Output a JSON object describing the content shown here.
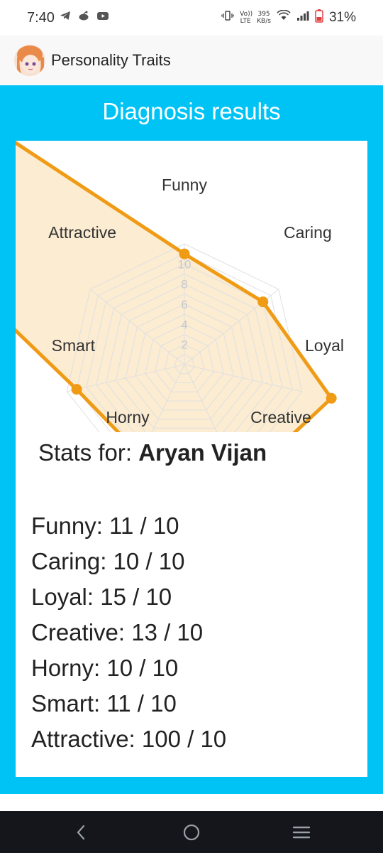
{
  "status_bar": {
    "time": "7:40",
    "network_speed_value": "395",
    "network_speed_unit": "KB/s",
    "volte_label": "Vo)) LTE",
    "battery": "31%",
    "left_icons": [
      "telegram-icon",
      "reddit-icon",
      "youtube-icon"
    ],
    "right_icons": [
      "vibrate-icon",
      "volte-icon",
      "wifi-icon",
      "signal-icon",
      "battery-icon"
    ]
  },
  "app_bar": {
    "title": "Personality Traits"
  },
  "results": {
    "heading": "Diagnosis results",
    "stats_prefix": "Stats for: ",
    "stats_name": "Aryan Vijan",
    "stats": [
      {
        "label": "Funny: 11 / 10"
      },
      {
        "label": "Caring: 10 / 10"
      },
      {
        "label": "Loyal: 15 / 10"
      },
      {
        "label": "Creative: 13 / 10"
      },
      {
        "label": "Horny: 10 / 10"
      },
      {
        "label": "Smart: 11 / 10"
      },
      {
        "label": "Attractive: 100 / 10"
      }
    ]
  },
  "chart_data": {
    "type": "radar",
    "categories": [
      "Funny",
      "Caring",
      "Loyal",
      "Creative",
      "Horny",
      "Smart",
      "Attractive"
    ],
    "values": [
      11,
      10,
      15,
      13,
      10,
      11,
      100
    ],
    "scale_ticks": [
      "2",
      "4",
      "6",
      "8",
      "10"
    ],
    "rmax": 12,
    "stroke_color": "#f09b15",
    "fill_color": "#fbecd2",
    "grid_color": "#e0e0e0"
  },
  "nav_bar": {
    "buttons": [
      "back-icon",
      "home-icon",
      "recents-icon"
    ]
  }
}
